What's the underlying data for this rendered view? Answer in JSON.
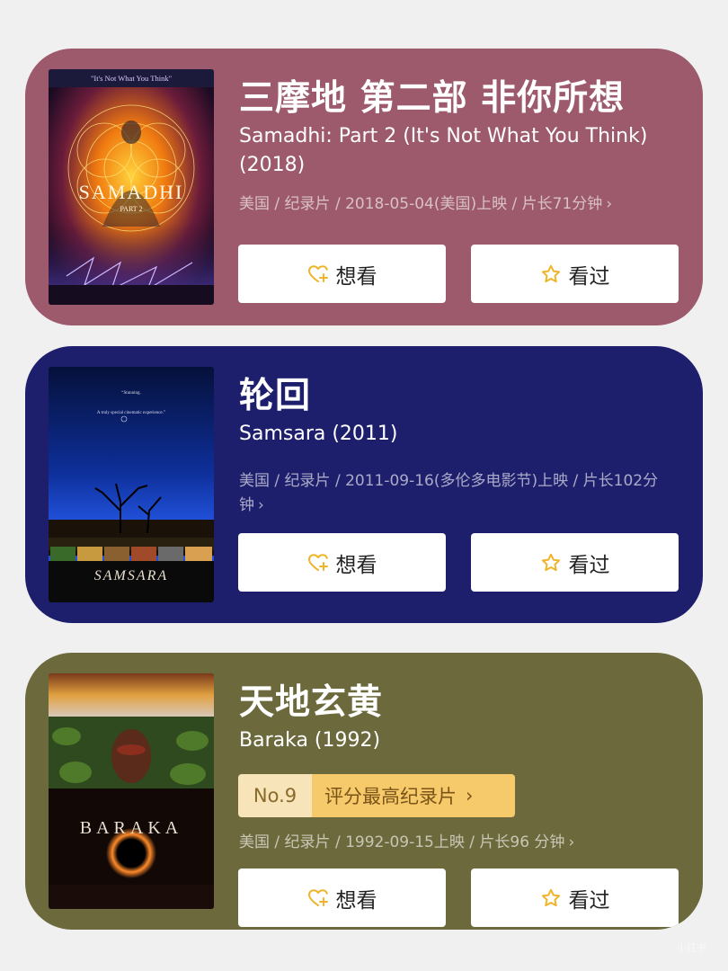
{
  "colors": {
    "card1_bg": "#9c5a6c",
    "card2_bg": "#1e1f6c",
    "card3_bg": "#6c6a3c",
    "button_icon": "#f0b429",
    "rank_no_bg": "#f7e4b8",
    "rank_label_bg": "#f6c96a"
  },
  "buttons": {
    "want_label": "想看",
    "want_icon": "heart-plus-icon",
    "seen_label": "看过",
    "seen_icon": "star-icon"
  },
  "movies": [
    {
      "title": "三摩地 第二部 非你所想",
      "original_title": "Samadhi: Part 2 (It's Not What You Think) (2018)",
      "meta": "美国 / 纪录片 / 2018-05-04(美国)上映 / 片长71分钟",
      "poster": {
        "tagline": "\"It's Not What You Think\"",
        "logo_text": "SAMADHI",
        "part_text": "PART 2"
      }
    },
    {
      "title": "轮回",
      "original_title": "Samsara (2011)",
      "meta": "美国 / 纪录片 / 2011-09-16(多伦多电影节)上映 / 片长102分钟",
      "poster": {
        "logo_text": "SAMSARA"
      }
    },
    {
      "title": "天地玄黄",
      "original_title": "Baraka (1992)",
      "rank": {
        "number": "No.9",
        "label": "评分最高纪录片"
      },
      "meta": "美国 / 纪录片 / 1992-09-15上映 / 片长96 分钟",
      "poster": {
        "logo_text": "BARAKA"
      }
    }
  ],
  "watermark": "小红书"
}
